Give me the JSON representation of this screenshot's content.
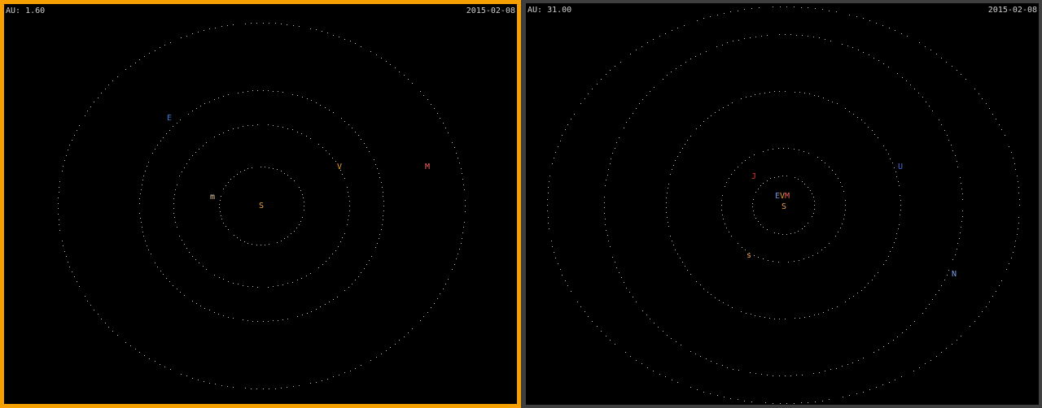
{
  "panes": [
    {
      "au_label": "AU: 1.60",
      "date": "2015-02-08",
      "selected": true,
      "bodies": [
        {
          "glyph": "S",
          "name": "Sun",
          "color": "#e8a050"
        },
        {
          "glyph": "m",
          "name": "Mercury",
          "color": "#e6c8a0"
        },
        {
          "glyph": "V",
          "name": "Venus",
          "color": "#e8a030"
        },
        {
          "glyph": "E",
          "name": "Earth",
          "color": "#3a7ad0"
        },
        {
          "glyph": "M",
          "name": "Mars",
          "color": "#f06060"
        }
      ]
    },
    {
      "au_label": "AU: 31.00",
      "date": "2015-02-08",
      "selected": false,
      "bodies": [
        {
          "glyph": "S",
          "name": "Sun",
          "color": "#e8a050"
        },
        {
          "glyph": "E",
          "name": "Earth",
          "color": "#7a8ad8"
        },
        {
          "glyph": "V",
          "name": "Venus",
          "color": "#e8a030"
        },
        {
          "glyph": "M",
          "name": "Mars",
          "color": "#f06060"
        },
        {
          "glyph": "J",
          "name": "Jupiter",
          "color": "#e03030"
        },
        {
          "glyph": "s",
          "name": "Saturn",
          "color": "#e8a050"
        },
        {
          "glyph": "U",
          "name": "Uranus",
          "color": "#4a6ad8"
        },
        {
          "glyph": "N",
          "name": "Neptune",
          "color": "#7a9ae8"
        }
      ]
    }
  ],
  "colors": {
    "selected_border": "#f5a000",
    "unselected_border": "#3f3f3f",
    "orbit_dot": "#bdbdbd",
    "hud_text": "#cfcfcf",
    "background": "#000000"
  }
}
